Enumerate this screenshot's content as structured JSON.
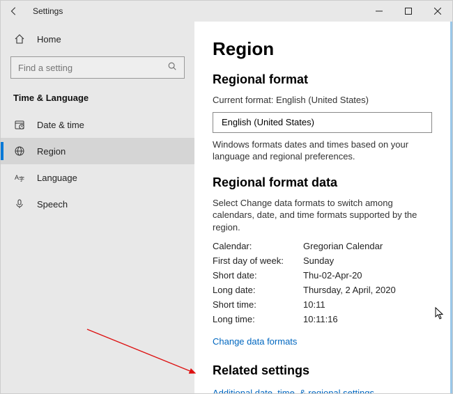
{
  "titlebar": {
    "title": "Settings"
  },
  "sidebar": {
    "home_label": "Home",
    "search_placeholder": "Find a setting",
    "category_heading": "Time & Language",
    "items": [
      {
        "label": "Date & time"
      },
      {
        "label": "Region"
      },
      {
        "label": "Language"
      },
      {
        "label": "Speech"
      }
    ]
  },
  "main": {
    "page_title": "Region",
    "section1_heading": "Regional format",
    "current_format_label": "Current format: English (United States)",
    "select_value": "English (United States)",
    "format_desc": "Windows formats dates and times based on your language and regional preferences.",
    "section2_heading": "Regional format data",
    "data_desc": "Select Change data formats to switch among calendars, date, and time formats supported by the region.",
    "rows": [
      {
        "key": "Calendar:",
        "val": "Gregorian Calendar"
      },
      {
        "key": "First day of week:",
        "val": "Sunday"
      },
      {
        "key": "Short date:",
        "val": "Thu-02-Apr-20"
      },
      {
        "key": "Long date:",
        "val": "Thursday, 2 April, 2020"
      },
      {
        "key": "Short time:",
        "val": "10:11"
      },
      {
        "key": "Long time:",
        "val": "10:11:16"
      }
    ],
    "change_link": "Change data formats",
    "related_heading": "Related settings",
    "related_link": "Additional date, time, & regional settings"
  }
}
